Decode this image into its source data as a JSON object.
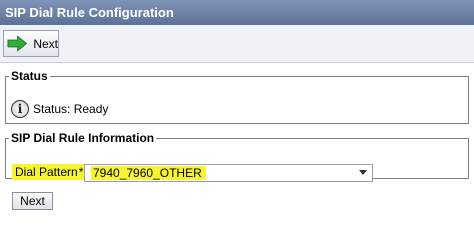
{
  "window": {
    "title": "SIP Dial Rule Configuration"
  },
  "toolbar": {
    "next_label": "Next",
    "next_icon": "green-right-arrow-icon"
  },
  "status": {
    "legend": "Status",
    "text": "Status: Ready",
    "icon": "info-icon",
    "icon_glyph": "i"
  },
  "info": {
    "legend": "SIP Dial Rule Information",
    "dial_pattern_label": "Dial Pattern",
    "required_marker": "*",
    "dial_pattern_value": "7940_7960_OTHER",
    "highlight_color": "#f7f52c"
  },
  "footer": {
    "next_label": "Next"
  }
}
